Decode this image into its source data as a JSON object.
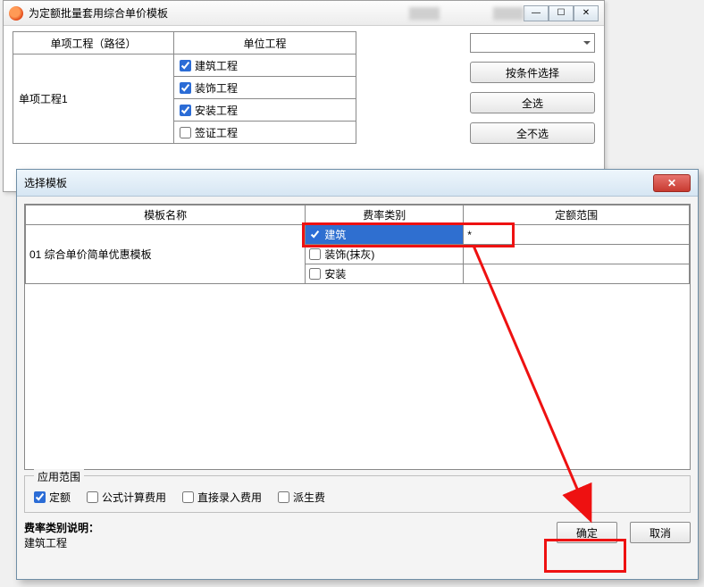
{
  "back": {
    "title": "为定额批量套用综合单价模板",
    "headers": {
      "path": "单项工程（路径）",
      "unit": "单位工程"
    },
    "path_name": "单项工程1",
    "units": [
      {
        "label": "建筑工程",
        "checked": true
      },
      {
        "label": "装饰工程",
        "checked": true
      },
      {
        "label": "安装工程",
        "checked": true
      },
      {
        "label": "签证工程",
        "checked": false
      }
    ],
    "buttons": {
      "filter": "按条件选择",
      "all": "全选",
      "none": "全不选"
    },
    "win": {
      "min": "—",
      "max": "☐",
      "close": "✕"
    }
  },
  "front": {
    "title": "选择模板",
    "headers": {
      "name": "模板名称",
      "rate": "费率类别",
      "scope": "定额范围"
    },
    "template_name": "01 综合单价简单优惠模板",
    "rate_rows": [
      {
        "label": "建筑",
        "checked": true,
        "selected": true,
        "scope": "*"
      },
      {
        "label": "装饰(抹灰)",
        "checked": false,
        "selected": false,
        "scope": ""
      },
      {
        "label": "安装",
        "checked": false,
        "selected": false,
        "scope": ""
      }
    ],
    "scope": {
      "title": "应用范围",
      "options": [
        {
          "label": "定额",
          "checked": true
        },
        {
          "label": "公式计算费用",
          "checked": false
        },
        {
          "label": "直接录入费用",
          "checked": false
        },
        {
          "label": "派生费",
          "checked": false
        }
      ]
    },
    "desc": {
      "title": "费率类别说明：",
      "text": "建筑工程"
    },
    "buttons": {
      "ok": "确定",
      "cancel": "取消"
    }
  }
}
